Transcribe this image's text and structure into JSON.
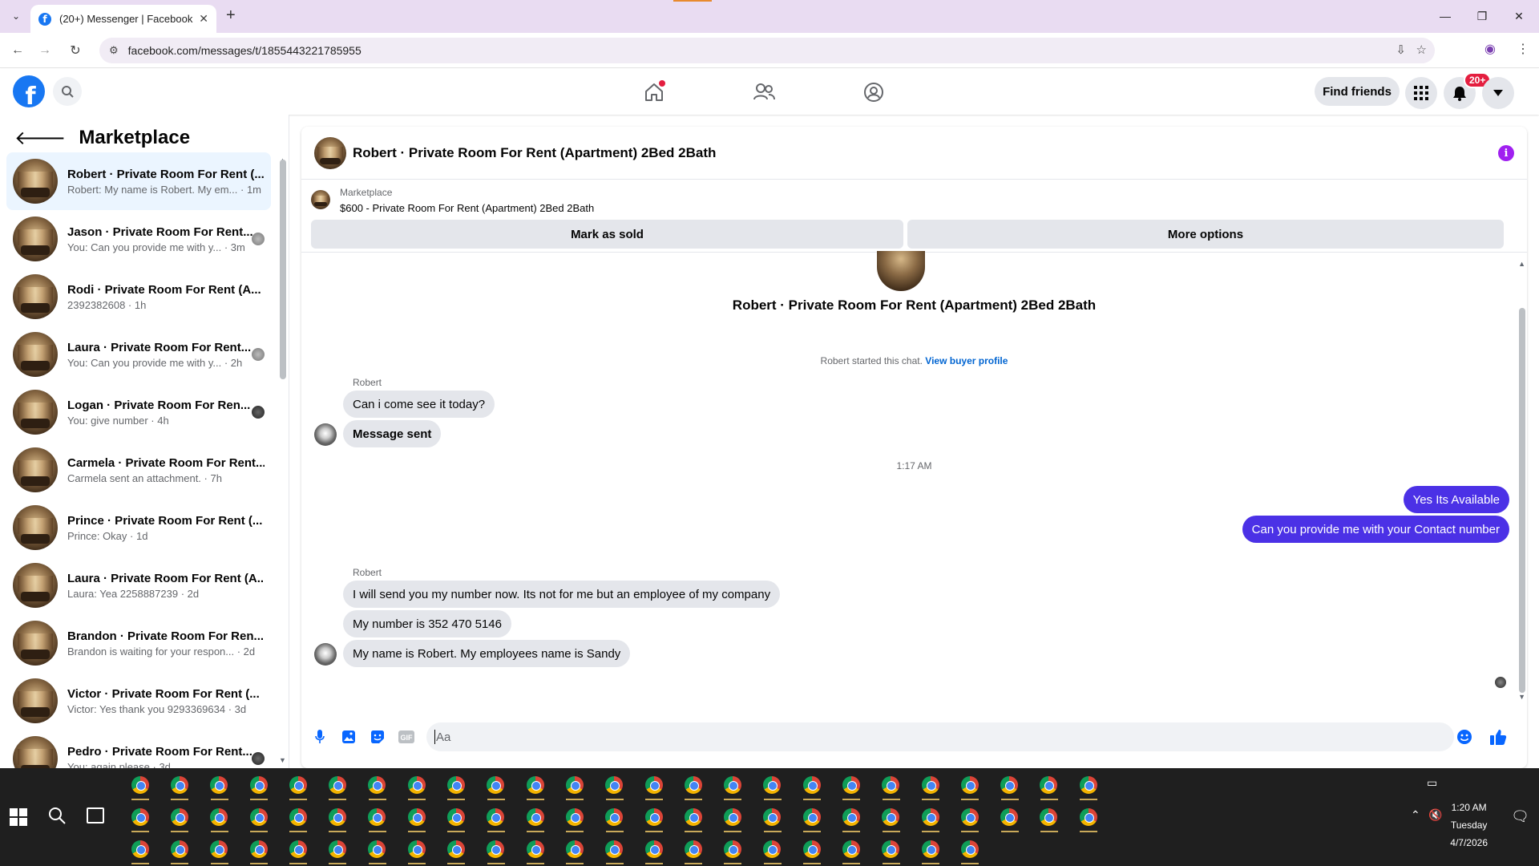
{
  "browser": {
    "tab_title": "(20+) Messenger | Facebook",
    "url": "facebook.com/messages/t/1855443221785955"
  },
  "header": {
    "find_friends": "Find friends",
    "notif_badge": "20+"
  },
  "sidebar": {
    "title": "Marketplace",
    "conversations": [
      {
        "name": "Robert · Private Room For Rent (...",
        "snippet": "Robert: My name is Robert. My em... · 1m",
        "active": true
      },
      {
        "name": "Jason · Private Room For Rent...",
        "snippet": "You: Can you provide me with y... · 3m"
      },
      {
        "name": "Rodi · Private Room For Rent (A...",
        "snippet": "2392382608 · 1h"
      },
      {
        "name": "Laura · Private Room For Rent...",
        "snippet": "You: Can you provide me with y... · 2h"
      },
      {
        "name": "Logan · Private Room For Ren...",
        "snippet": "You: give number · 4h"
      },
      {
        "name": "Carmela · Private Room For Rent...",
        "snippet": "Carmela sent an attachment. · 7h"
      },
      {
        "name": "Prince · Private Room For Rent (...",
        "snippet": "Prince: Okay · 1d"
      },
      {
        "name": "Laura · Private Room For Rent (A...",
        "snippet": "Laura: Yea 2258887239 · 2d"
      },
      {
        "name": "Brandon · Private Room For Ren...",
        "snippet": "Brandon is waiting for your respon... · 2d"
      },
      {
        "name": "Victor · Private Room For Rent (...",
        "snippet": "Victor: Yes thank you 9293369634 · 3d"
      },
      {
        "name": "Pedro · Private Room For Rent...",
        "snippet": "You: again please · 3d"
      }
    ]
  },
  "chat": {
    "title": "Robert · Private Room For Rent (Apartment) 2Bed 2Bath",
    "marketplace_label": "Marketplace",
    "listing": "$600 - Private Room For Rent (Apartment) 2Bed 2Bath",
    "mark_sold": "Mark as sold",
    "more_options": "More options",
    "thread_title": "Robert · Private Room For Rent (Apartment) 2Bed 2Bath",
    "started_text": "Robert started this chat.",
    "buyer_profile": "View buyer profile",
    "sender1": "Robert",
    "msg1": "Can i come see it today?",
    "msg2": "Message sent",
    "timestamp": "1:17 AM",
    "out1": "Yes Its Available",
    "out2": "Can you provide me with your Contact number",
    "sender2": "Robert",
    "msg3": "I will send you my number now. Its not for me but an employee of my company",
    "msg4": "My number is 352 470 5146",
    "msg5": "My name is Robert. My employees name is Sandy",
    "input_placeholder": "Aa"
  },
  "taskbar": {
    "time": "1:20 AM",
    "day": "Tuesday",
    "date": "4/7/2026"
  }
}
